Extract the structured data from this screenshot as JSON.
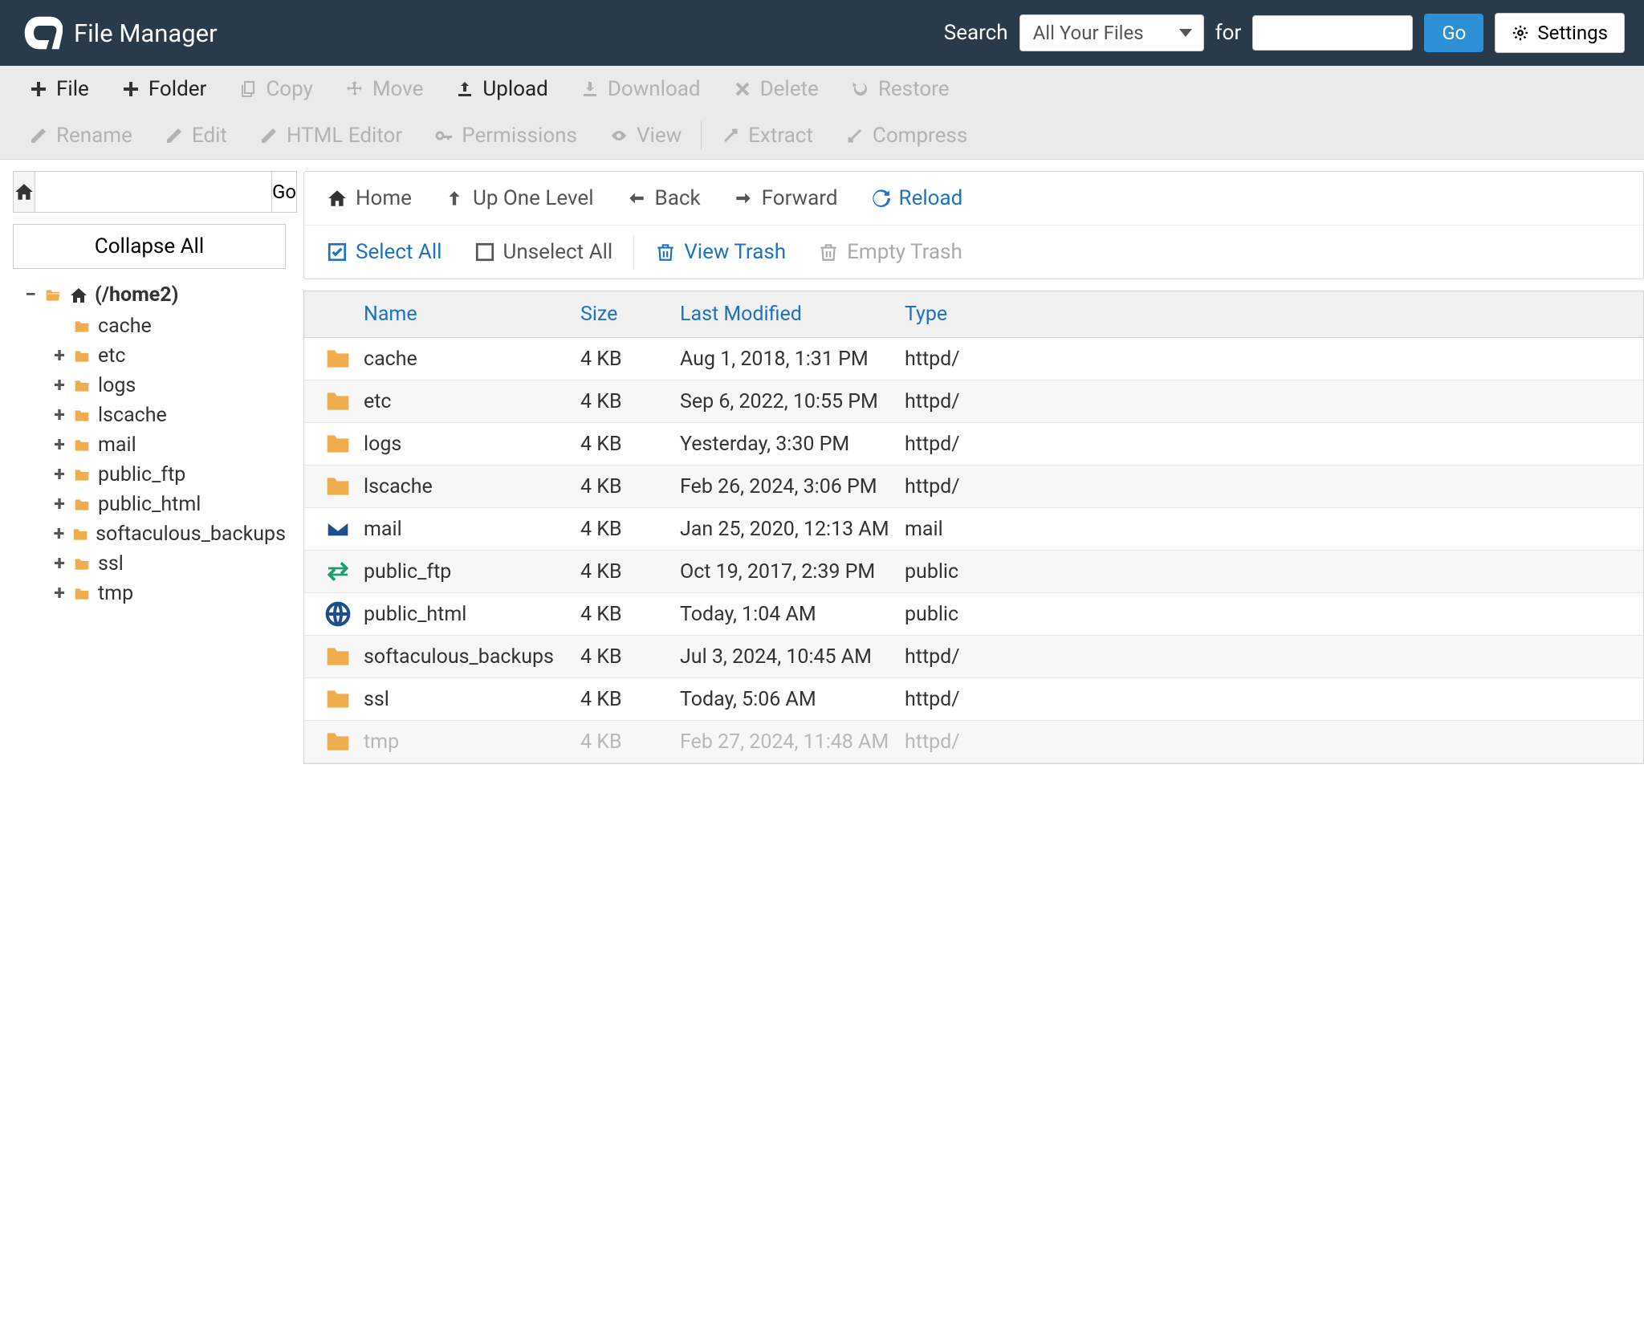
{
  "header": {
    "app_title": "File Manager",
    "search_label": "Search",
    "dropdown_value": "All Your Files",
    "for_label": "for",
    "go_label": "Go",
    "settings_label": "Settings"
  },
  "toolbar": {
    "file": "File",
    "folder": "Folder",
    "copy": "Copy",
    "move": "Move",
    "upload": "Upload",
    "download": "Download",
    "delete": "Delete",
    "restore": "Restore",
    "rename": "Rename",
    "edit": "Edit",
    "html_editor": "HTML Editor",
    "permissions": "Permissions",
    "view": "View",
    "extract": "Extract",
    "compress": "Compress"
  },
  "sidebar": {
    "go_label": "Go",
    "collapse_label": "Collapse All",
    "root_label": "(/home2)",
    "items": [
      {
        "name": "cache",
        "expandable": false
      },
      {
        "name": "etc",
        "expandable": true
      },
      {
        "name": "logs",
        "expandable": true
      },
      {
        "name": "lscache",
        "expandable": true
      },
      {
        "name": "mail",
        "expandable": true
      },
      {
        "name": "public_ftp",
        "expandable": true
      },
      {
        "name": "public_html",
        "expandable": true
      },
      {
        "name": "softaculous_backups",
        "expandable": true
      },
      {
        "name": "ssl",
        "expandable": true
      },
      {
        "name": "tmp",
        "expandable": true
      }
    ]
  },
  "nav": {
    "home": "Home",
    "up": "Up One Level",
    "back": "Back",
    "forward": "Forward",
    "reload": "Reload",
    "select_all": "Select All",
    "unselect_all": "Unselect All",
    "view_trash": "View Trash",
    "empty_trash": "Empty Trash"
  },
  "table": {
    "headers": {
      "name": "Name",
      "size": "Size",
      "modified": "Last Modified",
      "type": "Type"
    },
    "rows": [
      {
        "icon": "folder",
        "name": "cache",
        "size": "4 KB",
        "modified": "Aug 1, 2018, 1:31 PM",
        "type": "httpd/"
      },
      {
        "icon": "folder",
        "name": "etc",
        "size": "4 KB",
        "modified": "Sep 6, 2022, 10:55 PM",
        "type": "httpd/"
      },
      {
        "icon": "folder",
        "name": "logs",
        "size": "4 KB",
        "modified": "Yesterday, 3:30 PM",
        "type": "httpd/"
      },
      {
        "icon": "folder",
        "name": "lscache",
        "size": "4 KB",
        "modified": "Feb 26, 2024, 3:06 PM",
        "type": "httpd/"
      },
      {
        "icon": "mail",
        "name": "mail",
        "size": "4 KB",
        "modified": "Jan 25, 2020, 12:13 AM",
        "type": "mail"
      },
      {
        "icon": "ftp",
        "name": "public_ftp",
        "size": "4 KB",
        "modified": "Oct 19, 2017, 2:39 PM",
        "type": "public"
      },
      {
        "icon": "globe",
        "name": "public_html",
        "size": "4 KB",
        "modified": "Today, 1:04 AM",
        "type": "public"
      },
      {
        "icon": "folder",
        "name": "softaculous_backups",
        "size": "4 KB",
        "modified": "Jul 3, 2024, 10:45 AM",
        "type": "httpd/"
      },
      {
        "icon": "folder",
        "name": "ssl",
        "size": "4 KB",
        "modified": "Today, 5:06 AM",
        "type": "httpd/"
      },
      {
        "icon": "folder",
        "name": "tmp",
        "size": "4 KB",
        "modified": "Feb 27, 2024, 11:48 AM",
        "type": "httpd/",
        "dim": true
      }
    ]
  }
}
